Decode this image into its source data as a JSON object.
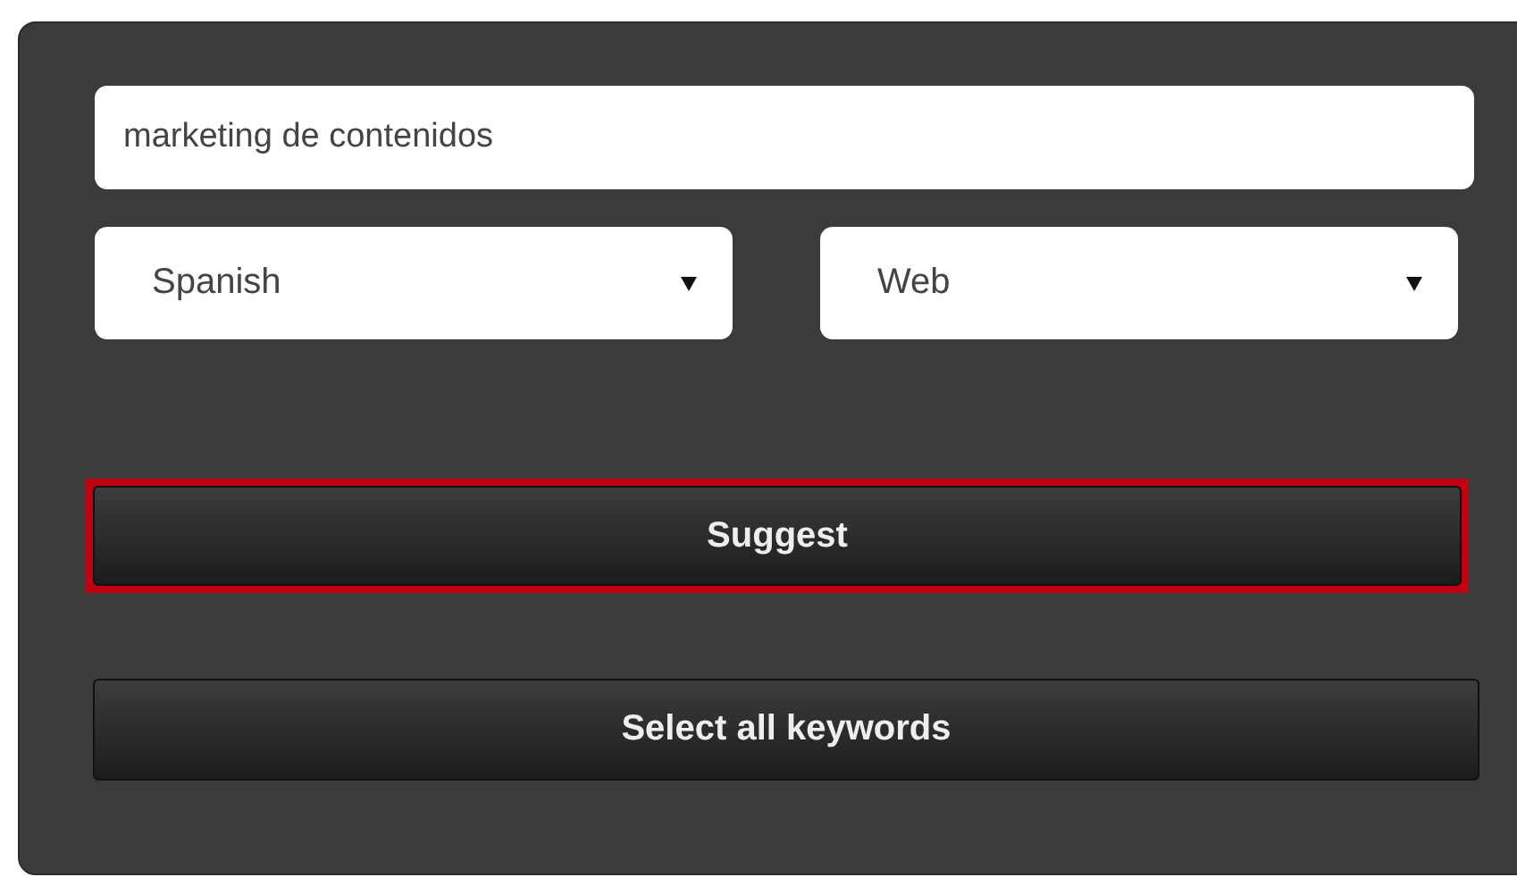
{
  "search": {
    "value": "marketing de contenidos"
  },
  "selects": [
    {
      "value": "Spanish"
    },
    {
      "value": "Web"
    }
  ],
  "buttons": [
    {
      "label": "Suggest",
      "highlighted": true
    },
    {
      "label": "Select all keywords",
      "highlighted": false
    }
  ]
}
